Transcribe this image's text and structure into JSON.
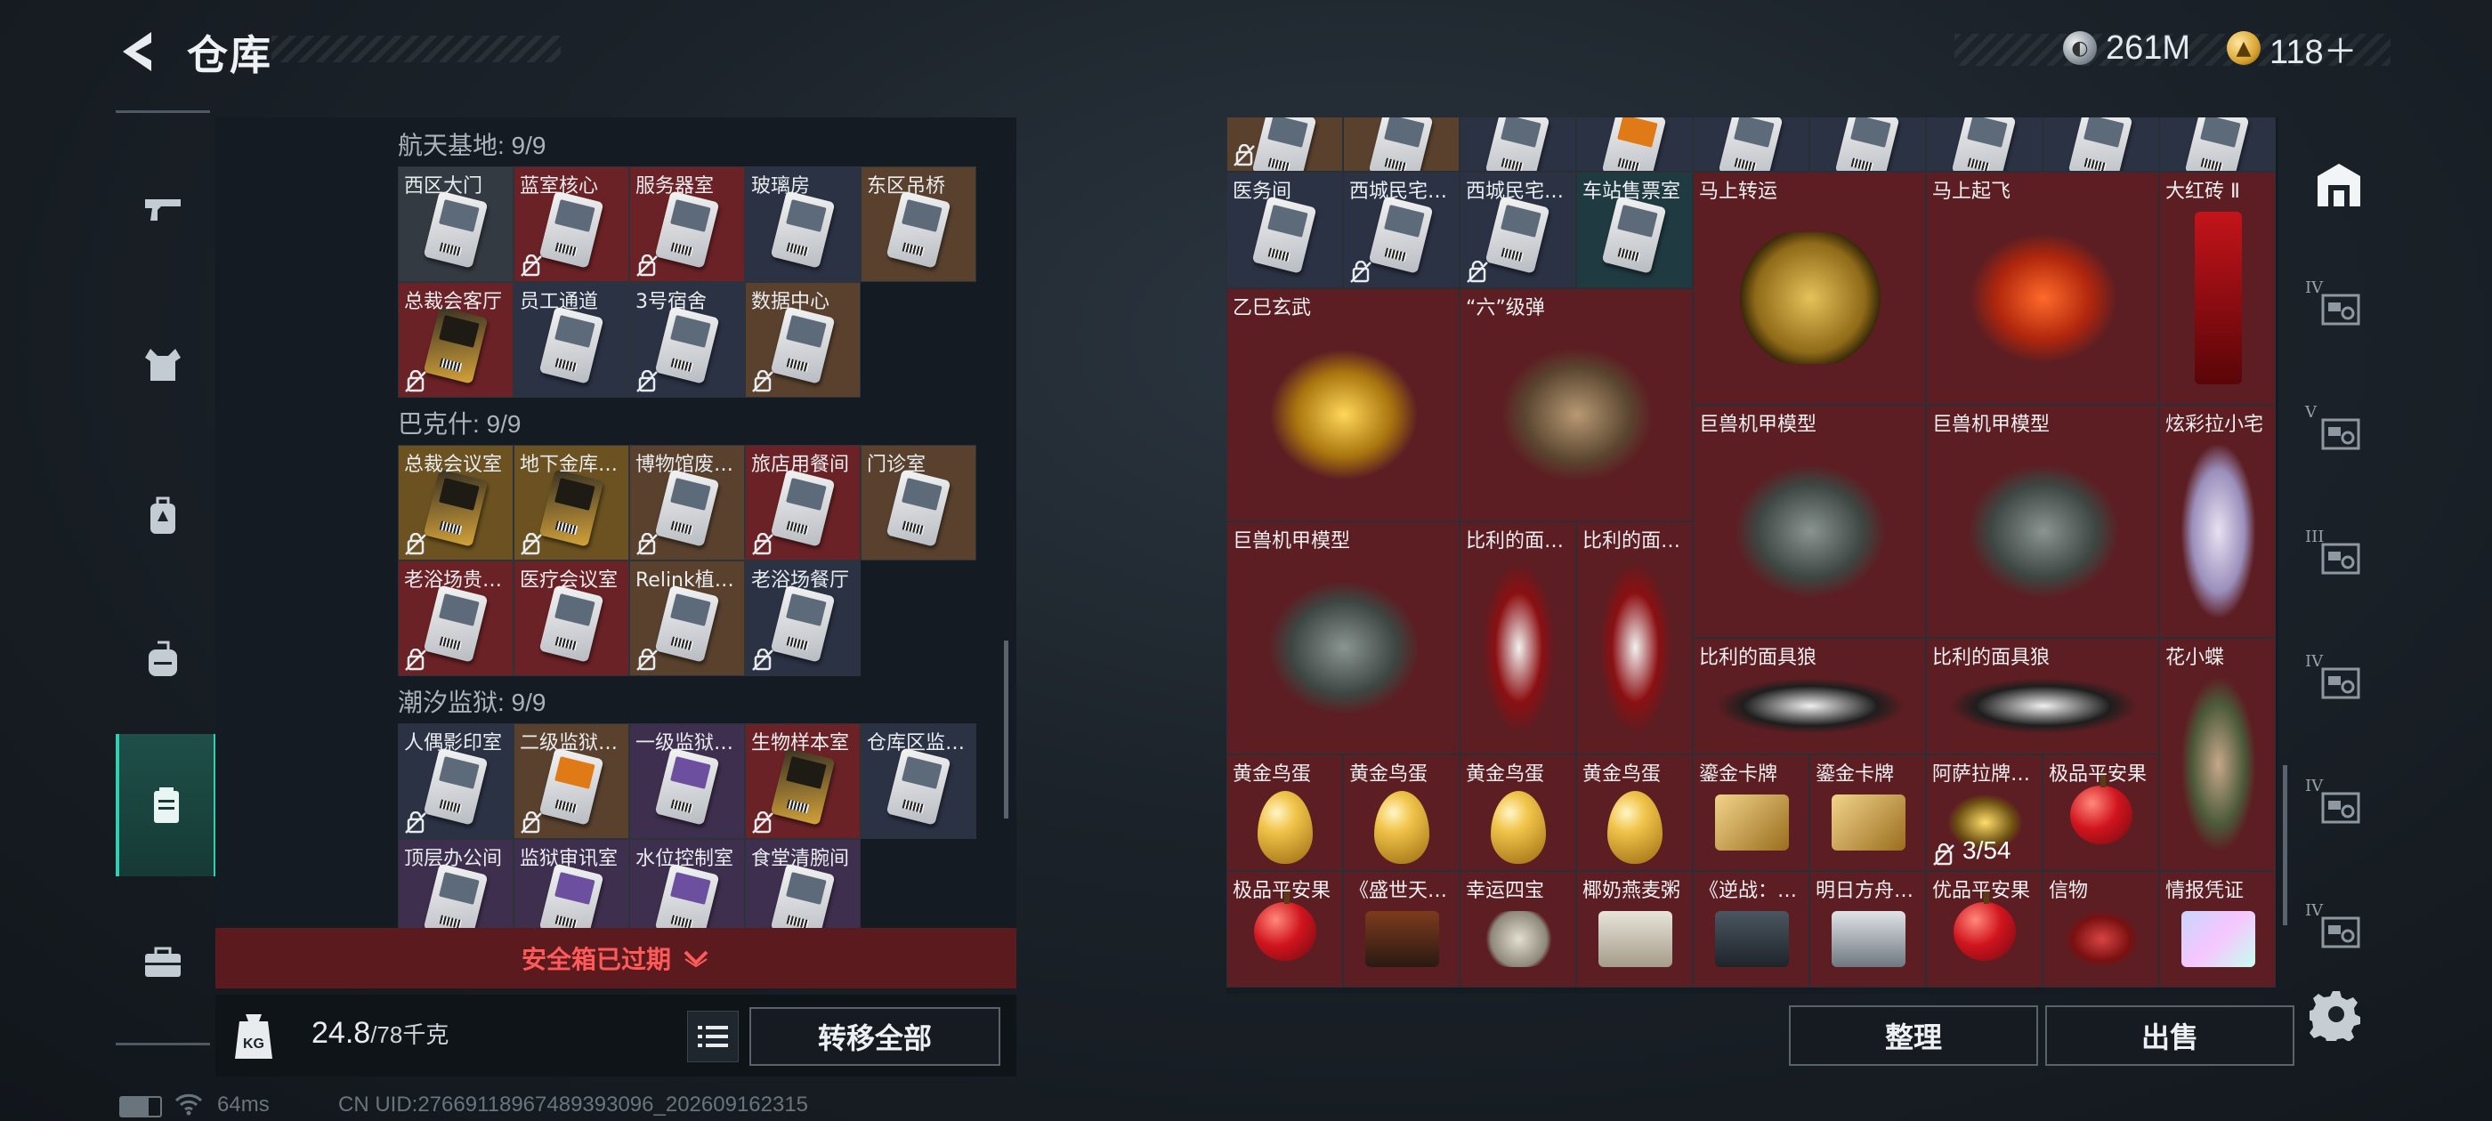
{
  "header": {
    "title": "仓库"
  },
  "currency": [
    {
      "icon": "silver-coin-icon",
      "value": "261M"
    },
    {
      "icon": "gold-coin-icon",
      "value": "118＋"
    }
  ],
  "left_nav": [
    {
      "name": "nav-weapons",
      "icon": "gun-icon"
    },
    {
      "name": "nav-armor",
      "icon": "vest-icon"
    },
    {
      "name": "nav-backpack-alt",
      "icon": "backpack-alt-icon"
    },
    {
      "name": "nav-backpack",
      "icon": "backpack-icon"
    },
    {
      "name": "nav-safe-box",
      "icon": "safe-box-icon",
      "active": true
    },
    {
      "name": "nav-toolbox",
      "icon": "toolbox-icon"
    }
  ],
  "left_panel": {
    "sections": [
      {
        "title": "航天基地: 9/9",
        "items": [
          {
            "label": "西区大门",
            "bg": "gray",
            "card": "",
            "nolock": false
          },
          {
            "label": "蓝室核心",
            "bg": "red",
            "card": "",
            "nolock": true
          },
          {
            "label": "服务器室",
            "bg": "red",
            "card": "",
            "nolock": true
          },
          {
            "label": "玻璃房",
            "bg": "blue",
            "card": "",
            "nolock": false
          },
          {
            "label": "东区吊桥",
            "bg": "brown",
            "card": "",
            "nolock": false
          },
          {
            "label": "总裁会客厅",
            "bg": "red",
            "card": "gold",
            "nolock": true
          },
          {
            "label": "员工通道",
            "bg": "blue",
            "card": "",
            "nolock": false
          },
          {
            "label": "3号宿舍",
            "bg": "blue",
            "card": "",
            "nolock": true
          },
          {
            "label": "数据中心",
            "bg": "brown",
            "card": "",
            "nolock": true
          }
        ]
      },
      {
        "title": "巴克什: 9/9",
        "items": [
          {
            "label": "总裁会议室",
            "bg": "gold",
            "card": "gold",
            "nolock": true
          },
          {
            "label": "地下金库…",
            "bg": "gold",
            "card": "gold",
            "nolock": true
          },
          {
            "label": "博物馆废…",
            "bg": "brown",
            "card": "",
            "nolock": true
          },
          {
            "label": "旅店用餐间",
            "bg": "red",
            "card": "",
            "nolock": true
          },
          {
            "label": "门诊室",
            "bg": "brown",
            "card": "",
            "nolock": false
          },
          {
            "label": "老浴场贵…",
            "bg": "red",
            "card": "",
            "nolock": true
          },
          {
            "label": "医疗会议室",
            "bg": "red",
            "card": "",
            "nolock": false
          },
          {
            "label": "Relink植…",
            "bg": "brown",
            "card": "",
            "nolock": true
          },
          {
            "label": "老浴场餐厅",
            "bg": "blue",
            "card": "",
            "nolock": true
          }
        ]
      },
      {
        "title": "潮汐监狱: 9/9",
        "items": [
          {
            "label": "人偶影印室",
            "bg": "blue",
            "card": "",
            "nolock": true
          },
          {
            "label": "二级监狱…",
            "bg": "brown",
            "card": "orange",
            "nolock": true
          },
          {
            "label": "一级监狱…",
            "bg": "purple",
            "card": "purple",
            "nolock": false
          },
          {
            "label": "生物样本室",
            "bg": "red",
            "card": "gold",
            "nolock": true
          },
          {
            "label": "仓库区监…",
            "bg": "blue",
            "card": "",
            "nolock": false
          },
          {
            "label": "顶层办公间",
            "bg": "purple",
            "card": "",
            "nolock": false
          },
          {
            "label": "监狱审讯室",
            "bg": "purple",
            "card": "purple",
            "nolock": false
          },
          {
            "label": "水位控制室",
            "bg": "purple",
            "card": "purple",
            "nolock": false
          },
          {
            "label": "食堂清腕间",
            "bg": "purple",
            "card": "",
            "nolock": false
          }
        ]
      }
    ],
    "expired_text": "安全箱已过期",
    "weight_value": "24.8",
    "weight_cap": "/78千克",
    "transfer_label": "转移全部"
  },
  "right_panel": {
    "top_row": [
      {
        "bg": "brown",
        "nolock": true
      },
      {
        "bg": "brown"
      },
      {
        "bg": "blue"
      },
      {
        "bg": "blue",
        "card": "orange"
      },
      {
        "bg": "blue"
      },
      {
        "bg": "blue"
      },
      {
        "bg": "blue"
      },
      {
        "bg": "blue"
      },
      {
        "bg": "blue"
      }
    ],
    "items": [
      {
        "label": "医务间",
        "type": "card",
        "bg": "blue"
      },
      {
        "label": "西城民宅…",
        "type": "card",
        "bg": "blue",
        "nolock": true
      },
      {
        "label": "西城民宅…",
        "type": "card",
        "bg": "blue",
        "card": "gold",
        "nolock": true
      },
      {
        "label": "车站售票室",
        "type": "card",
        "bg": "teal"
      },
      {
        "label": "马上转运",
        "type": "coin"
      },
      {
        "label": "马上起飞",
        "type": "horse"
      },
      {
        "label": "大红砖 Ⅱ",
        "type": "brick"
      },
      {
        "label": "乙巳玄武",
        "type": "snake"
      },
      {
        "label": "“六”级弹",
        "type": "fist"
      },
      {
        "label": "巨兽机甲模型",
        "type": "mech"
      },
      {
        "label": "巨兽机甲模型",
        "type": "mech"
      },
      {
        "label": "炫彩拉小宅",
        "type": "doll"
      },
      {
        "label": "巨兽机甲模型",
        "type": "mech"
      },
      {
        "label": "比利的面…",
        "type": "puppet"
      },
      {
        "label": "比利的面…",
        "type": "puppet"
      },
      {
        "label": "比利的面具狼",
        "type": "puppet-lying"
      },
      {
        "label": "比利的面具狼",
        "type": "puppet-lying"
      },
      {
        "label": "花小蝶",
        "type": "girl"
      },
      {
        "label": "黄金鸟蛋",
        "type": "egg"
      },
      {
        "label": "黄金鸟蛋",
        "type": "egg"
      },
      {
        "label": "黄金鸟蛋",
        "type": "egg"
      },
      {
        "label": "黄金鸟蛋",
        "type": "egg"
      },
      {
        "label": "鎏金卡牌",
        "type": "goldcard"
      },
      {
        "label": "鎏金卡牌",
        "type": "goldcard"
      },
      {
        "label": "阿萨拉牌…",
        "type": "lantern",
        "count": "3/54",
        "nolock": true
      },
      {
        "label": "极品平安果",
        "type": "apple"
      },
      {
        "label": "极品平安果",
        "type": "apple"
      },
      {
        "label": "《盛世天…",
        "type": "book"
      },
      {
        "label": "幸运四宝",
        "type": "stone"
      },
      {
        "label": "椰奶燕麦粥",
        "type": "jar"
      },
      {
        "label": "《逆战：…",
        "type": "book2"
      },
      {
        "label": "明日方舟…",
        "type": "disc"
      },
      {
        "label": "优品平安果",
        "type": "apple"
      },
      {
        "label": "信物",
        "type": "mask"
      },
      {
        "label": "情报凭证",
        "type": "holo"
      }
    ],
    "sort_label": "整理",
    "sell_label": "出售"
  },
  "right_tabs": [
    {
      "name": "tab-storage-main",
      "tier": ""
    },
    {
      "name": "tab-box-iv-1",
      "tier": "IV"
    },
    {
      "name": "tab-box-v",
      "tier": "V"
    },
    {
      "name": "tab-box-iii",
      "tier": "III"
    },
    {
      "name": "tab-box-iv-2",
      "tier": "IV"
    },
    {
      "name": "tab-box-iv-3",
      "tier": "IV"
    },
    {
      "name": "tab-box-iv-4",
      "tier": "IV"
    }
  ],
  "status_bar": {
    "ping": "64ms",
    "uid": "CN UID:276691189674893930​96_202609162315"
  },
  "colors": {
    "accent": "#2fd1b2",
    "danger": "#ff5a5a",
    "item_red": "#6b2226"
  }
}
